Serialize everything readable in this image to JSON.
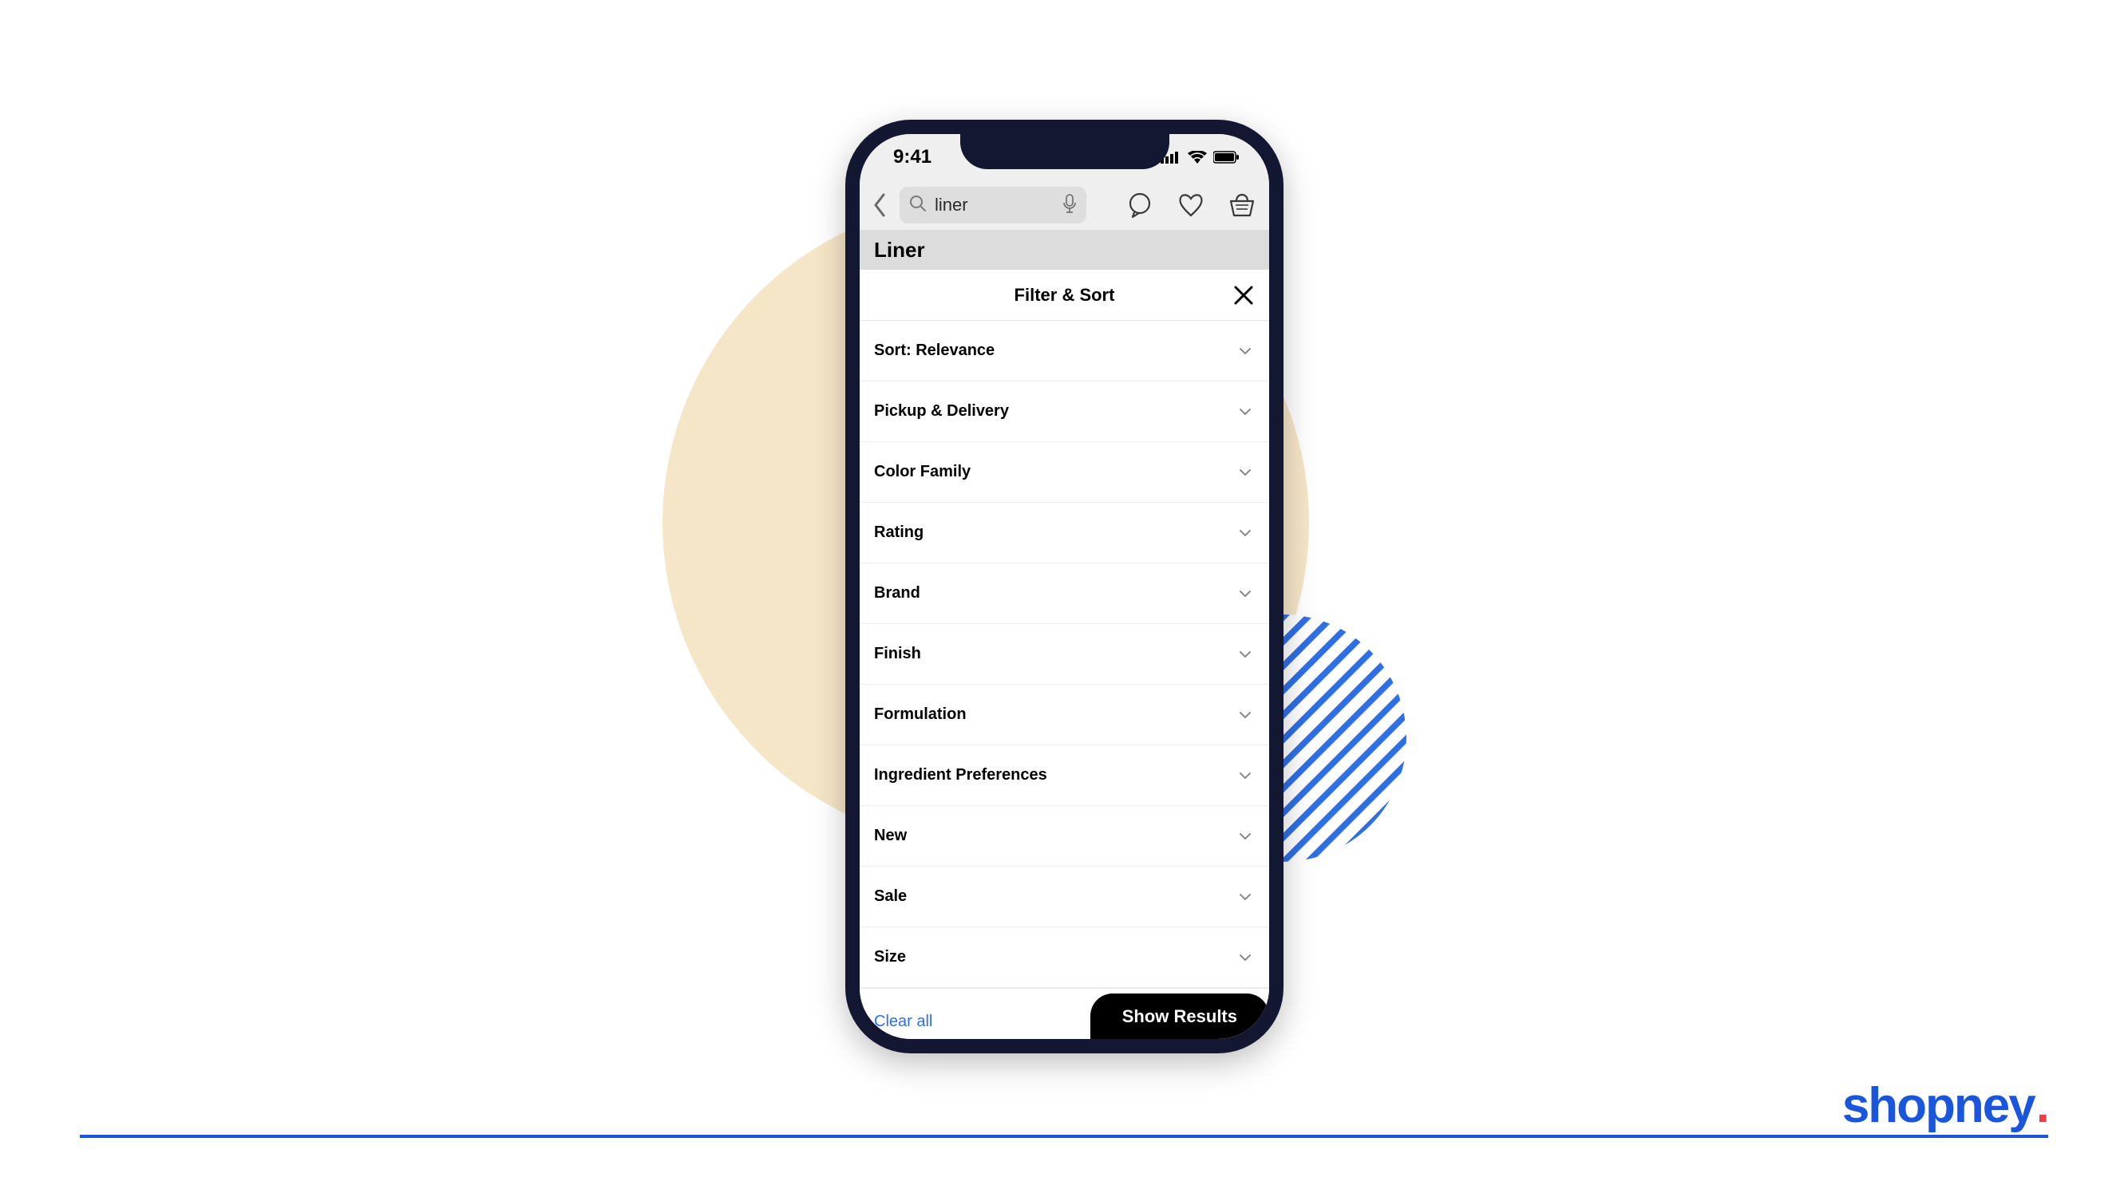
{
  "brand": {
    "name": "shopney",
    "dot": "."
  },
  "status": {
    "time": "9:41"
  },
  "search": {
    "query": "liner"
  },
  "category": {
    "title": "Liner"
  },
  "filter_sheet": {
    "title": "Filter & Sort",
    "clear_all": "Clear all",
    "show_results": "Show Results",
    "rows": [
      {
        "label": "Sort: Relevance"
      },
      {
        "label": "Pickup & Delivery"
      },
      {
        "label": "Color Family"
      },
      {
        "label": "Rating"
      },
      {
        "label": "Brand"
      },
      {
        "label": "Finish"
      },
      {
        "label": "Formulation"
      },
      {
        "label": "Ingredient Preferences"
      },
      {
        "label": "New"
      },
      {
        "label": "Sale"
      },
      {
        "label": "Size"
      }
    ]
  }
}
